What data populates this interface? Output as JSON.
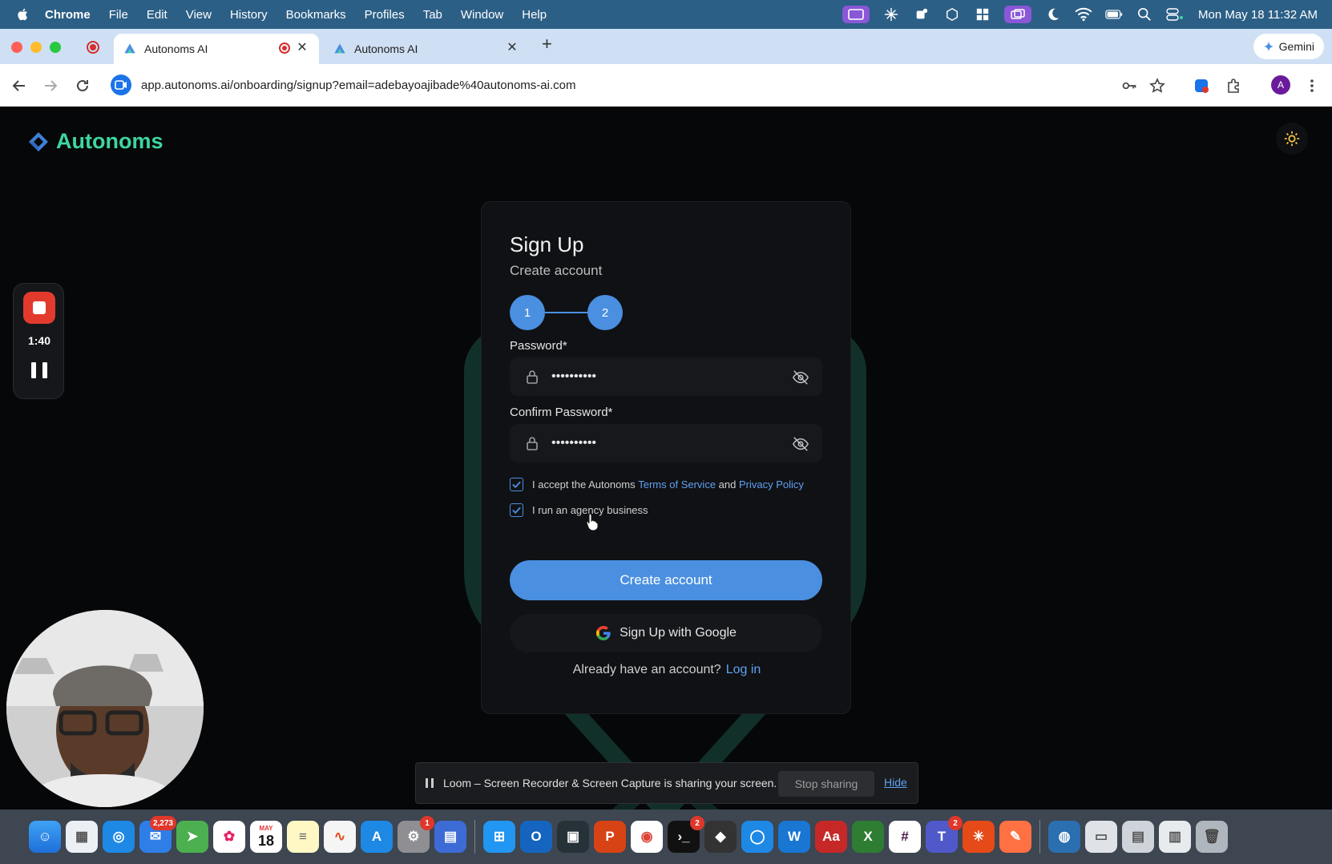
{
  "menubar": {
    "app": "Chrome",
    "items": [
      "File",
      "Edit",
      "View",
      "History",
      "Bookmarks",
      "Profiles",
      "Tab",
      "Window",
      "Help"
    ],
    "clock": "Mon May 18  11:32 AM"
  },
  "tabs": [
    {
      "title": "Autonoms AI",
      "active": true
    },
    {
      "title": "Autonoms AI",
      "active": false
    }
  ],
  "gemini_label": "Gemini",
  "omnibox": {
    "url": "app.autonoms.ai/onboarding/signup?email=adebayoajibade%40autonoms-ai.com"
  },
  "profile_initial": "A",
  "brand": {
    "name": "Autonoms",
    "color": "#3dd6a0"
  },
  "form": {
    "title": "Sign Up",
    "subtitle": "Create account",
    "steps": [
      "1",
      "2"
    ],
    "password_label": "Password*",
    "password_value": "••••••••••",
    "confirm_label": "Confirm Password*",
    "confirm_value": "••••••••••",
    "terms_prefix": "I accept the Autonoms ",
    "terms_link": "Terms of Service",
    "terms_and": " and ",
    "privacy_link": "Privacy Policy",
    "terms_checked": true,
    "agency_label": "I run an agency business",
    "agency_checked": true,
    "create_button": "Create account",
    "google_button": "Sign Up with Google",
    "login_prompt": "Already have an account?",
    "login_link": "Log in",
    "accent": "#4a8fe0"
  },
  "recorder": {
    "elapsed": "1:40"
  },
  "sharebar": {
    "message": "Loom – Screen Recorder & Screen Capture is sharing your screen.",
    "stop_label": "Stop sharing",
    "hide_label": "Hide"
  },
  "dock": {
    "badges": {
      "mail": "2,273",
      "settings": "1",
      "terminal": "2",
      "teams": "2"
    },
    "calendar_month": "MAY",
    "calendar_day": "18"
  }
}
